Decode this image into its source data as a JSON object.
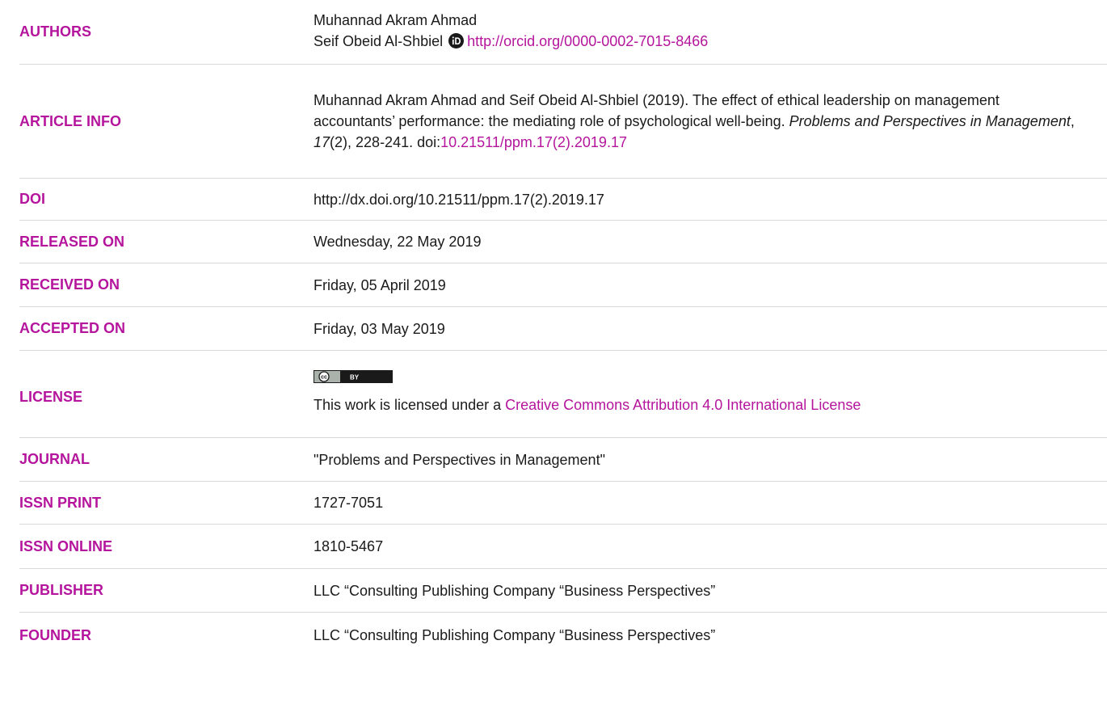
{
  "authors": {
    "label": "AUTHORS",
    "author1": "Muhannad Akram Ahmad",
    "author2": "Seif Obeid Al-Shbiel",
    "orcid_url": "http://orcid.org/0000-0002-7015-8466",
    "orcid_icon": "orcid-icon"
  },
  "article_info": {
    "label": "ARTICLE INFO",
    "authors_year": "Muhannad Akram Ahmad and Seif Obeid Al-Shbiel (2019). The effect of ethical leadership on management accountants’ performance: the mediating role of psychological well-being. ",
    "journal": "Problems and Perspectives in Management",
    "sep1": ", ",
    "volume": "17",
    "issue": "(2), 228-241. doi:",
    "doi_link": "10.21511/ppm.17(2).2019.17"
  },
  "doi": {
    "label": "DOI",
    "value": "http://dx.doi.org/10.21511/ppm.17(2).2019.17"
  },
  "released_on": {
    "label": "RELEASED ON",
    "value": "Wednesday, 22 May 2019"
  },
  "received_on": {
    "label": "RECEIVED ON",
    "value": "Friday, 05 April 2019"
  },
  "accepted_on": {
    "label": "ACCEPTED ON",
    "value": "Friday, 03 May 2019"
  },
  "license": {
    "label": "LICENSE",
    "badge_cc": "cc",
    "badge_by": "BY",
    "text_prefix": "This work is licensed under a ",
    "link_text": "Creative Commons Attribution 4.0 International License"
  },
  "journal": {
    "label": "JOURNAL",
    "value": "\"Problems and Perspectives in Management\""
  },
  "issn_print": {
    "label": "ISSN PRINT",
    "value": "1727-7051"
  },
  "issn_online": {
    "label": "ISSN ONLINE",
    "value": "1810-5467"
  },
  "publisher": {
    "label": "PUBLISHER",
    "value": "LLC “Consulting Publishing Company “Business Perspectives”"
  },
  "founder": {
    "label": "FOUNDER",
    "value": "LLC “Consulting Publishing Company “Business Perspectives”"
  },
  "colors": {
    "accent": "#b4159c",
    "text": "#1a1a1a",
    "divider": "#d9d9d9"
  }
}
